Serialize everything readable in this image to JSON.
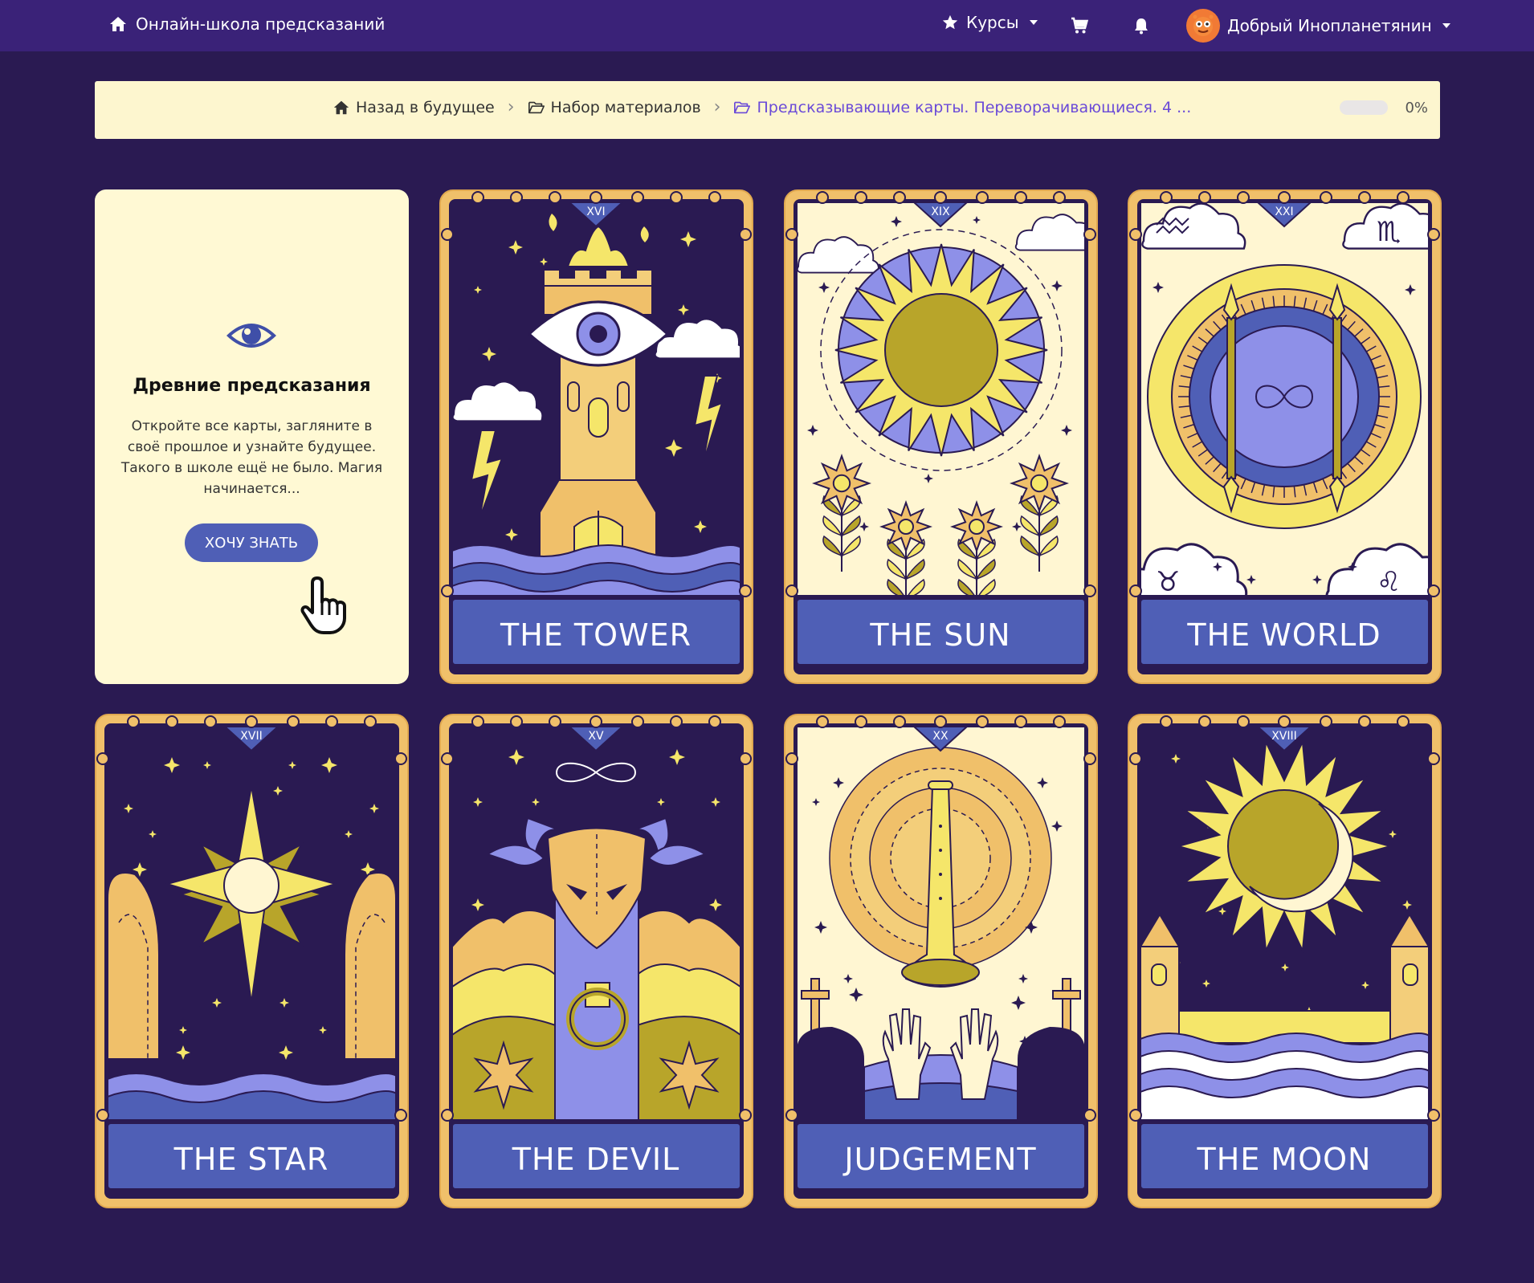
{
  "header": {
    "brand": "Онлайн-школа предсказаний",
    "brand_icon": "home-icon",
    "courses": "Курсы",
    "courses_icon": "star-icon",
    "cart_icon": "cart-icon",
    "bell_icon": "bell-icon",
    "user_name": "Добрый Инопланетянин"
  },
  "breadcrumb": {
    "items": [
      {
        "label": "Назад в будущее",
        "icon": "home-icon"
      },
      {
        "label": "Набор материалов",
        "icon": "folder-open-icon"
      },
      {
        "label": "Предсказывающие карты. Переворачивающиеся. 4 ...",
        "icon": "folder-open-icon"
      }
    ],
    "progress": 0,
    "progress_label": "0%"
  },
  "info": {
    "title": "Древние предсказания",
    "text": "Откройте все карты, загляните в своё прошлое и узнайте будущее. Такого в школе ещё не было. Магия начинается...",
    "button": "ХОЧУ ЗНАТЬ"
  },
  "cards": [
    {
      "numeral": "XVI",
      "name": "THE TOWER"
    },
    {
      "numeral": "XIX",
      "name": "THE SUN"
    },
    {
      "numeral": "XXI",
      "name": "THE WORLD"
    },
    {
      "numeral": "XVII",
      "name": "THE STAR"
    },
    {
      "numeral": "XV",
      "name": "THE DEVIL"
    },
    {
      "numeral": "XX",
      "name": "JUDGEMENT"
    },
    {
      "numeral": "XVIII",
      "name": "THE MOON"
    }
  ],
  "colors": {
    "background": "#2a1a52",
    "topbar": "#3a2278",
    "card_frame": "#f0c06a",
    "card_label_bg": "#4f5fb6",
    "accent": "#6a4ad8"
  }
}
